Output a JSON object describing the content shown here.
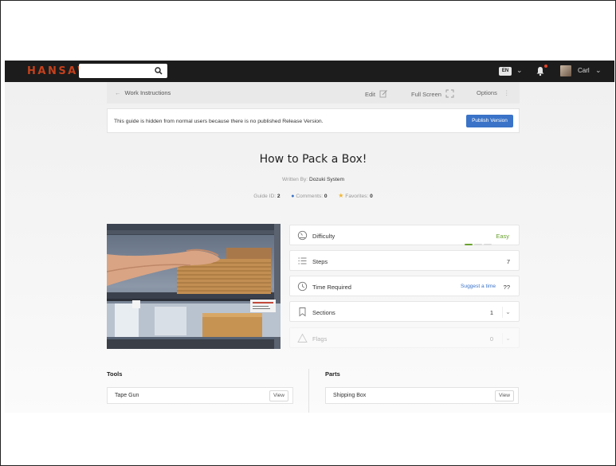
{
  "header": {
    "logo": "HANSAW",
    "search": {
      "placeholder": "",
      "value": ""
    },
    "language": "EN",
    "user": "Carl"
  },
  "subbar": {
    "back_label": "Work Instructions",
    "edit_label": "Edit",
    "fullscreen_label": "Full Screen",
    "options_label": "Options"
  },
  "notice": {
    "text": "This guide is hidden from normal users because there is no published Release Version.",
    "publish_label": "Publish Version"
  },
  "guide": {
    "title": "How to Pack a Box!",
    "written_by_label": "Written By:",
    "author": "Dozuki System",
    "guide_id_label": "Guide ID:",
    "guide_id": "2",
    "comments_label": "Comments:",
    "comments": "0",
    "favorites_label": "Favorites:",
    "favorites": "0"
  },
  "stats": {
    "difficulty": {
      "label": "Difficulty",
      "value": "Easy",
      "level": 1,
      "max": 3
    },
    "steps": {
      "label": "Steps",
      "value": "7"
    },
    "time": {
      "label": "Time Required",
      "suggest": "Suggest a time",
      "value": "??"
    },
    "sections": {
      "label": "Sections",
      "value": "1"
    },
    "flags": {
      "label": "Flags",
      "value": "0"
    }
  },
  "tools": {
    "title": "Tools",
    "items": [
      {
        "name": "Tape Gun",
        "action": "View"
      }
    ]
  },
  "parts": {
    "title": "Parts",
    "items": [
      {
        "name": "Shipping Box",
        "action": "View"
      }
    ]
  },
  "colors": {
    "brand": "#c4411c",
    "accent": "#3a73c8",
    "easy": "#6aa32f"
  }
}
